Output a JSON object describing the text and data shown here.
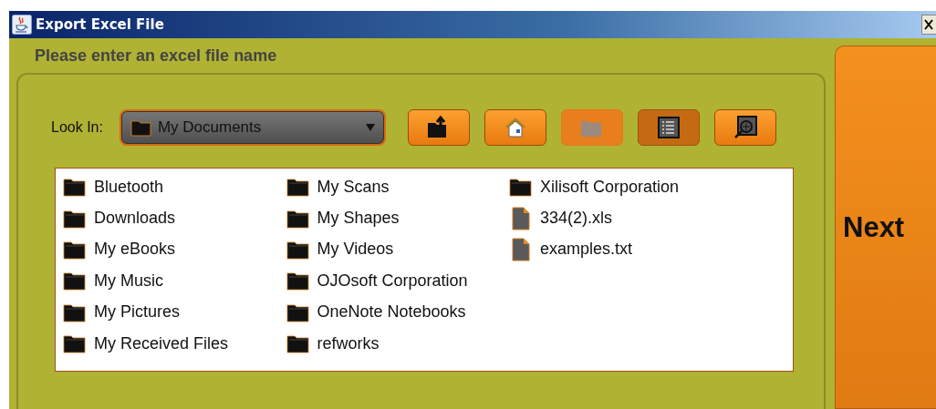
{
  "window": {
    "title": "Export Excel File"
  },
  "heading": "Please enter an excel file name",
  "look_in": {
    "label": "Look In:",
    "value": "My Documents"
  },
  "toolbar": [
    {
      "kind": "up",
      "disabled": false,
      "selected": false
    },
    {
      "kind": "home",
      "disabled": false,
      "selected": false
    },
    {
      "kind": "newfolder",
      "disabled": true,
      "selected": false
    },
    {
      "kind": "list",
      "disabled": false,
      "selected": true
    },
    {
      "kind": "details",
      "disabled": false,
      "selected": false
    }
  ],
  "files": [
    {
      "name": "Bluetooth",
      "kind": "folder"
    },
    {
      "name": "Downloads",
      "kind": "folder"
    },
    {
      "name": "My eBooks",
      "kind": "folder"
    },
    {
      "name": "My Music",
      "kind": "folder"
    },
    {
      "name": "My Pictures",
      "kind": "folder"
    },
    {
      "name": "My Received Files",
      "kind": "folder"
    },
    {
      "name": "My Scans",
      "kind": "folder"
    },
    {
      "name": "My Shapes",
      "kind": "folder"
    },
    {
      "name": "My Videos",
      "kind": "folder"
    },
    {
      "name": "OJOsoft Corporation",
      "kind": "folder"
    },
    {
      "name": "OneNote Notebooks",
      "kind": "folder"
    },
    {
      "name": "refworks",
      "kind": "folder"
    },
    {
      "name": "Xilisoft Corporation",
      "kind": "folder"
    },
    {
      "name": "334(2).xls",
      "kind": "file"
    },
    {
      "name": "examples.txt",
      "kind": "file"
    }
  ],
  "next_button": "Next"
}
